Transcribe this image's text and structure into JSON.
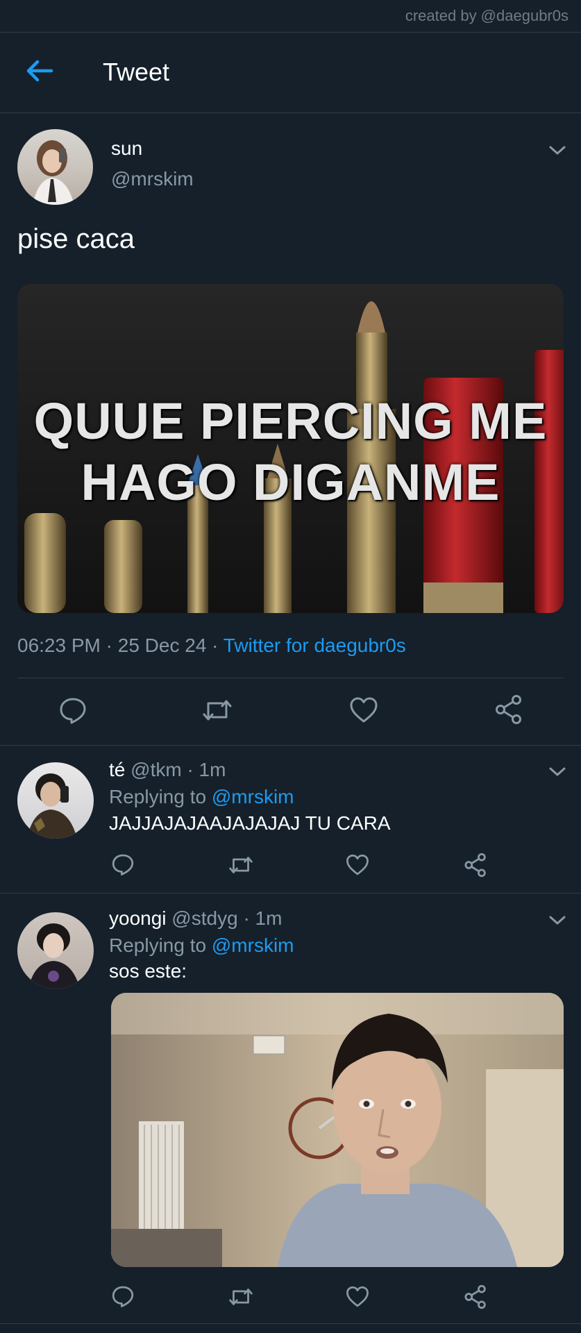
{
  "credit": "created by @daegubr0s",
  "header": {
    "title": "Tweet"
  },
  "tweet": {
    "name": "sun",
    "handle": "@mrskim",
    "text": "pise caca",
    "image_text": {
      "line1": "QUUE PIERCING ME",
      "line2": "HAGO DIGANME"
    },
    "time": "06:23 PM",
    "date": "25 Dec 24",
    "sep": "·",
    "source": "Twitter for daegubr0s"
  },
  "replies": [
    {
      "name": "té",
      "handle": "@tkm",
      "time": "· 1m",
      "replying_prefix": "Replying to",
      "replying_to": "@mrskim",
      "text": "JAJJAJAJAAJAJAJAJ TU CARA"
    },
    {
      "name": "yoongi",
      "handle": "@stdyg",
      "time": "· 1m",
      "replying_prefix": "Replying to",
      "replying_to": "@mrskim",
      "text": "sos este:"
    }
  ],
  "icons": {
    "back": "arrow-left-icon",
    "more": "chevron-down-icon",
    "reply": "comment-icon",
    "retweet": "retweet-icon",
    "like": "heart-icon",
    "share": "share-icon"
  },
  "colors": {
    "background": "#15202b",
    "accent": "#1d9bf0",
    "muted": "#8899a6",
    "divider": "#2f3d4a"
  }
}
